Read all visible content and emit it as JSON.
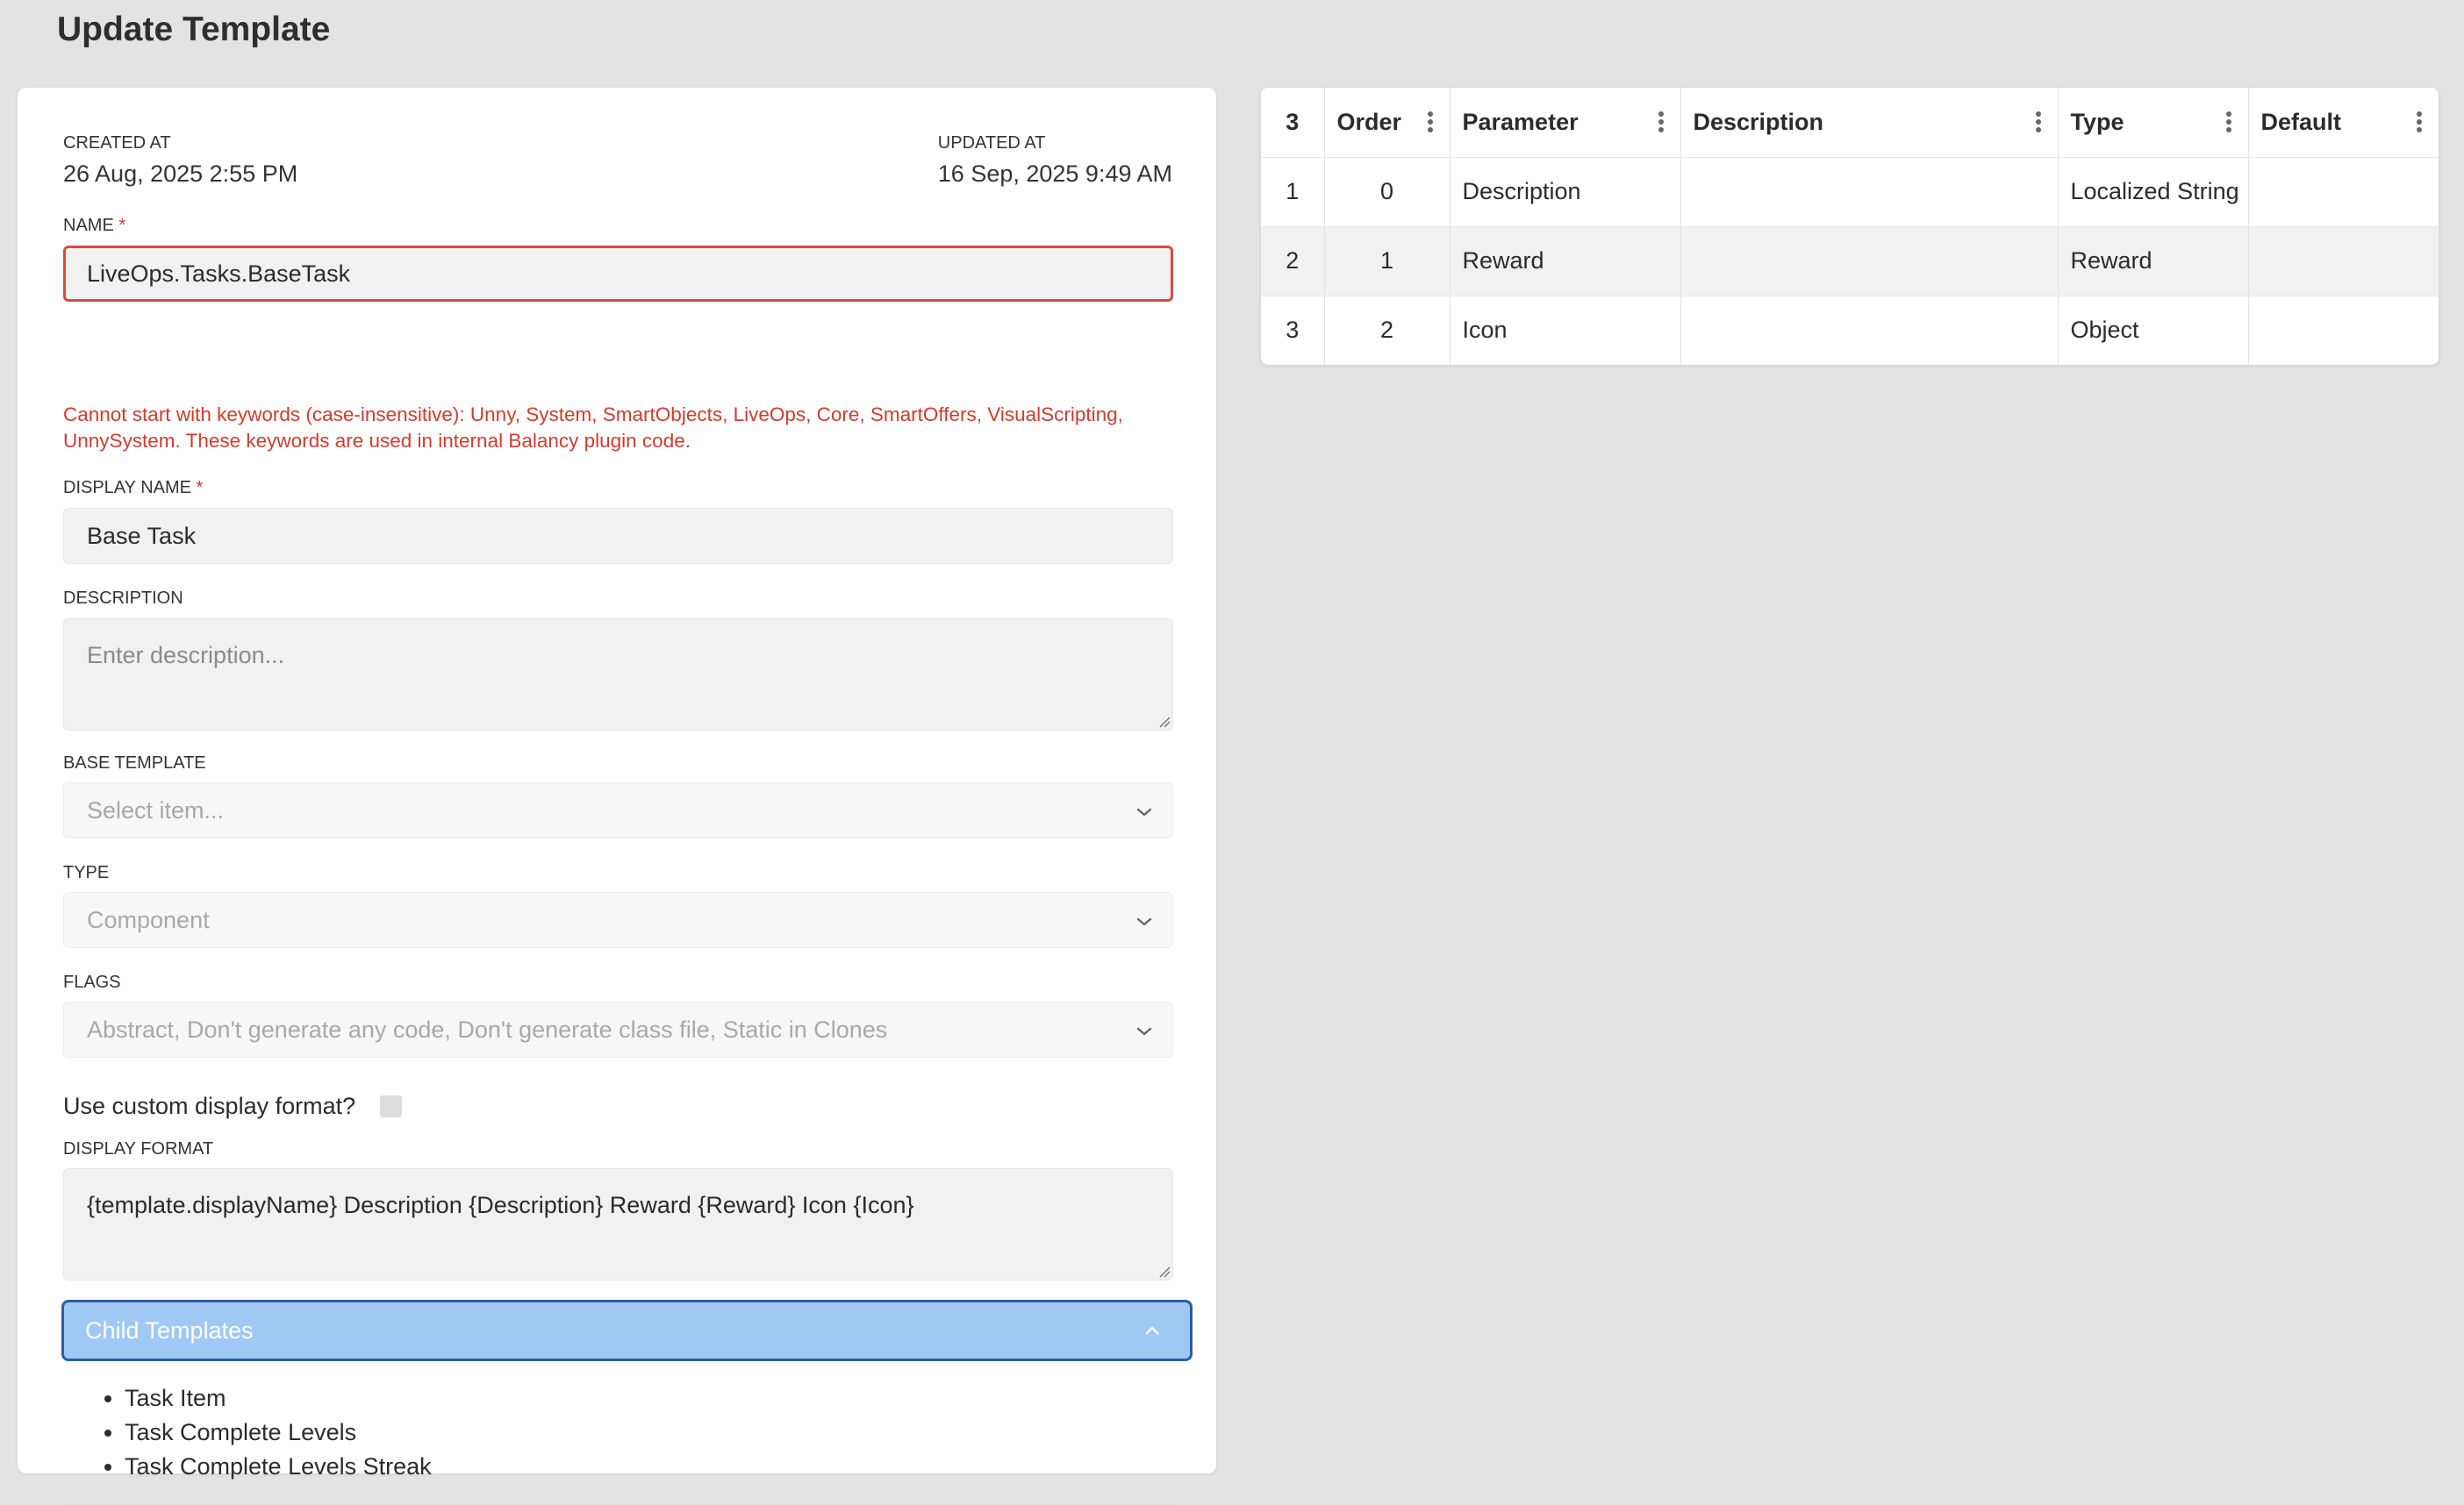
{
  "page": {
    "title": "Update Template"
  },
  "meta": {
    "created_label": "CREATED AT",
    "created_value": "26 Aug, 2025 2:55 PM",
    "updated_label": "UPDATED AT",
    "updated_value": "16 Sep, 2025 9:49 AM"
  },
  "form": {
    "name_label": "NAME",
    "name_value": "LiveOps.Tasks.BaseTask",
    "name_error": "Cannot start with keywords (case-insensitive): Unny, System, SmartObjects, LiveOps, Core, SmartOffers, VisualScripting, UnnySystem. These keywords are used in internal Balancy plugin code.",
    "display_name_label": "DISPLAY NAME",
    "display_name_value": "Base Task",
    "required_mark": "*",
    "description_label": "DESCRIPTION",
    "description_placeholder": "Enter description...",
    "base_template_label": "BASE TEMPLATE",
    "base_template_placeholder": "Select item...",
    "type_label": "TYPE",
    "type_value": "Component",
    "flags_label": "FLAGS",
    "flags_value": "Abstract, Don't generate any code, Don't generate class file, Static in Clones",
    "custom_format_label": "Use custom display format?",
    "display_format_label": "DISPLAY FORMAT",
    "display_format_value": "{template.displayName} Description {Description} Reward {Reward} Icon {Icon}"
  },
  "child_templates": {
    "label": "Child Templates",
    "items": [
      "Task Item",
      "Task Complete Levels",
      "Task Complete Levels Streak"
    ]
  },
  "table": {
    "headers": {
      "count": "3",
      "order": "Order",
      "parameter": "Parameter",
      "description": "Description",
      "type": "Type",
      "default": "Default"
    },
    "rows": [
      {
        "index": "1",
        "order": "0",
        "parameter": "Description",
        "description": "",
        "type": "Localized String",
        "default": ""
      },
      {
        "index": "2",
        "order": "1",
        "parameter": "Reward",
        "description": "",
        "type": "Reward",
        "default": ""
      },
      {
        "index": "3",
        "order": "2",
        "parameter": "Icon",
        "description": "",
        "type": "Object",
        "default": ""
      }
    ]
  },
  "colors": {
    "error": "#d13b2e",
    "accordion_bg": "#9fc9f4",
    "accordion_border": "#2a5ea6",
    "background": "#e3e3e3"
  },
  "icons": {
    "select_chevron": "chevron-down-icon",
    "accordion_chevron": "chevron-up-icon",
    "column_menu": "kebab-menu-icon"
  }
}
